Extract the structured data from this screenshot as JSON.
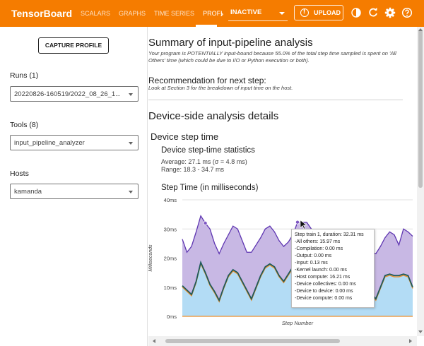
{
  "app": {
    "brand": "TensorBoard",
    "tabs": [
      "SCALARS",
      "GRAPHS",
      "TIME SERIES",
      "PROFI"
    ],
    "run_dropdown": "INACTIVE",
    "upload_label": "UPLOAD",
    "icons": [
      "chevron-right-icon",
      "dark-mode-icon",
      "refresh-icon",
      "settings-icon",
      "help-icon"
    ],
    "accent_color": "#f57c00"
  },
  "sidebar": {
    "capture_button": "CAPTURE PROFILE",
    "runs_label": "Runs (1)",
    "runs_value": "20220826-160519/2022_08_26_1...",
    "tools_label": "Tools (8)",
    "tools_value": "input_pipeline_analyzer",
    "hosts_label": "Hosts",
    "hosts_value": "kamanda"
  },
  "main": {
    "summary_title": "Summary of input-pipeline analysis",
    "summary_text": "Your program is POTENTIALLY input-bound because 55.0% of the total step time sampled is spent on 'All Others' time (which could be due to I/O or Python execution or both).",
    "recommendation_title": "Recommendation for next step:",
    "recommendation_text": "Look at Section 3 for the breakdown of input time on the host.",
    "device_title": "Device-side analysis details",
    "step_time_title": "Device step time",
    "stats_title": "Device step-time statistics",
    "average_line": "Average: 27.1 ms (σ = 4.8 ms)",
    "range_line": "Range: 18.3 - 34.7 ms",
    "chart_title": "Step Time (in milliseconds)"
  },
  "tooltip": {
    "lines": [
      "Step train 1, duration: 32.31 ms",
      "-All others: 15.97 ms",
      "-Compilation: 0.00 ms",
      "-Output: 0.00 ms",
      "-Input: 0.13 ms",
      "-Kernel launch: 0.00 ms",
      "-Host compute: 16.21 ms",
      "-Device collectives: 0.00 ms",
      "-Device to device: 0.00 ms",
      "-Device compute: 0.00 ms"
    ]
  },
  "chart_data": {
    "type": "area",
    "title": "Step Time (in milliseconds)",
    "xlabel": "Step Number",
    "ylabel": "Milliseconds",
    "ylim": [
      0,
      40
    ],
    "yticks": [
      "0ms",
      "10ms",
      "20ms",
      "30ms",
      "40ms"
    ],
    "grid": true,
    "stacked": true,
    "x": [
      0,
      1,
      2,
      3,
      4,
      5,
      6,
      7,
      8,
      9,
      10,
      11,
      12,
      13,
      14,
      15,
      16,
      17,
      18,
      19,
      20,
      21,
      22,
      23,
      24,
      25,
      26,
      27,
      28,
      29,
      30,
      31,
      32,
      33,
      34,
      35,
      36,
      37,
      38,
      39,
      40,
      41,
      42,
      43,
      44,
      45,
      46,
      47,
      48,
      49,
      50
    ],
    "series": [
      {
        "values": [
          10.5,
          9.0,
          7.5,
          12.0,
          18.5,
          15.0,
          11.0,
          8.5,
          5.5,
          10.0,
          14.0,
          16.0,
          15.0,
          12.0,
          9.0,
          6.0,
          10.0,
          14.0,
          17.0,
          18.0,
          17.0,
          14.0,
          12.0,
          14.5,
          17.0,
          17.5,
          16.5,
          16.5,
          16.0,
          16.0,
          16.0,
          13.0,
          11.0,
          9.0,
          7.0,
          10.0,
          14.0,
          16.5,
          15.0,
          12.0,
          9.0,
          8.0,
          6.0,
          10.0,
          14.0,
          14.5,
          14.0,
          14.0,
          14.5,
          14.0,
          10.0
        ],
        "color": "#1e5a5a"
      },
      {
        "values": [
          26.5,
          22.0,
          24.0,
          29.0,
          34.5,
          32.0,
          30.0,
          25.0,
          21.5,
          25.0,
          28.0,
          31.0,
          30.0,
          26.0,
          22.0,
          22.0,
          24.5,
          27.0,
          30.0,
          31.0,
          29.0,
          26.0,
          24.0,
          25.5,
          28.0,
          32.31,
          32.31,
          32.31,
          30.0,
          27.0,
          24.5,
          26.0,
          28.0,
          26.0,
          22.0,
          22.5,
          25.0,
          28.0,
          26.5,
          25.0,
          22.0,
          22.0,
          21.5,
          24.0,
          27.0,
          29.0,
          28.0,
          24.5,
          30.0,
          29.0,
          27.5
        ],
        "color": "#5e35b1"
      }
    ]
  }
}
